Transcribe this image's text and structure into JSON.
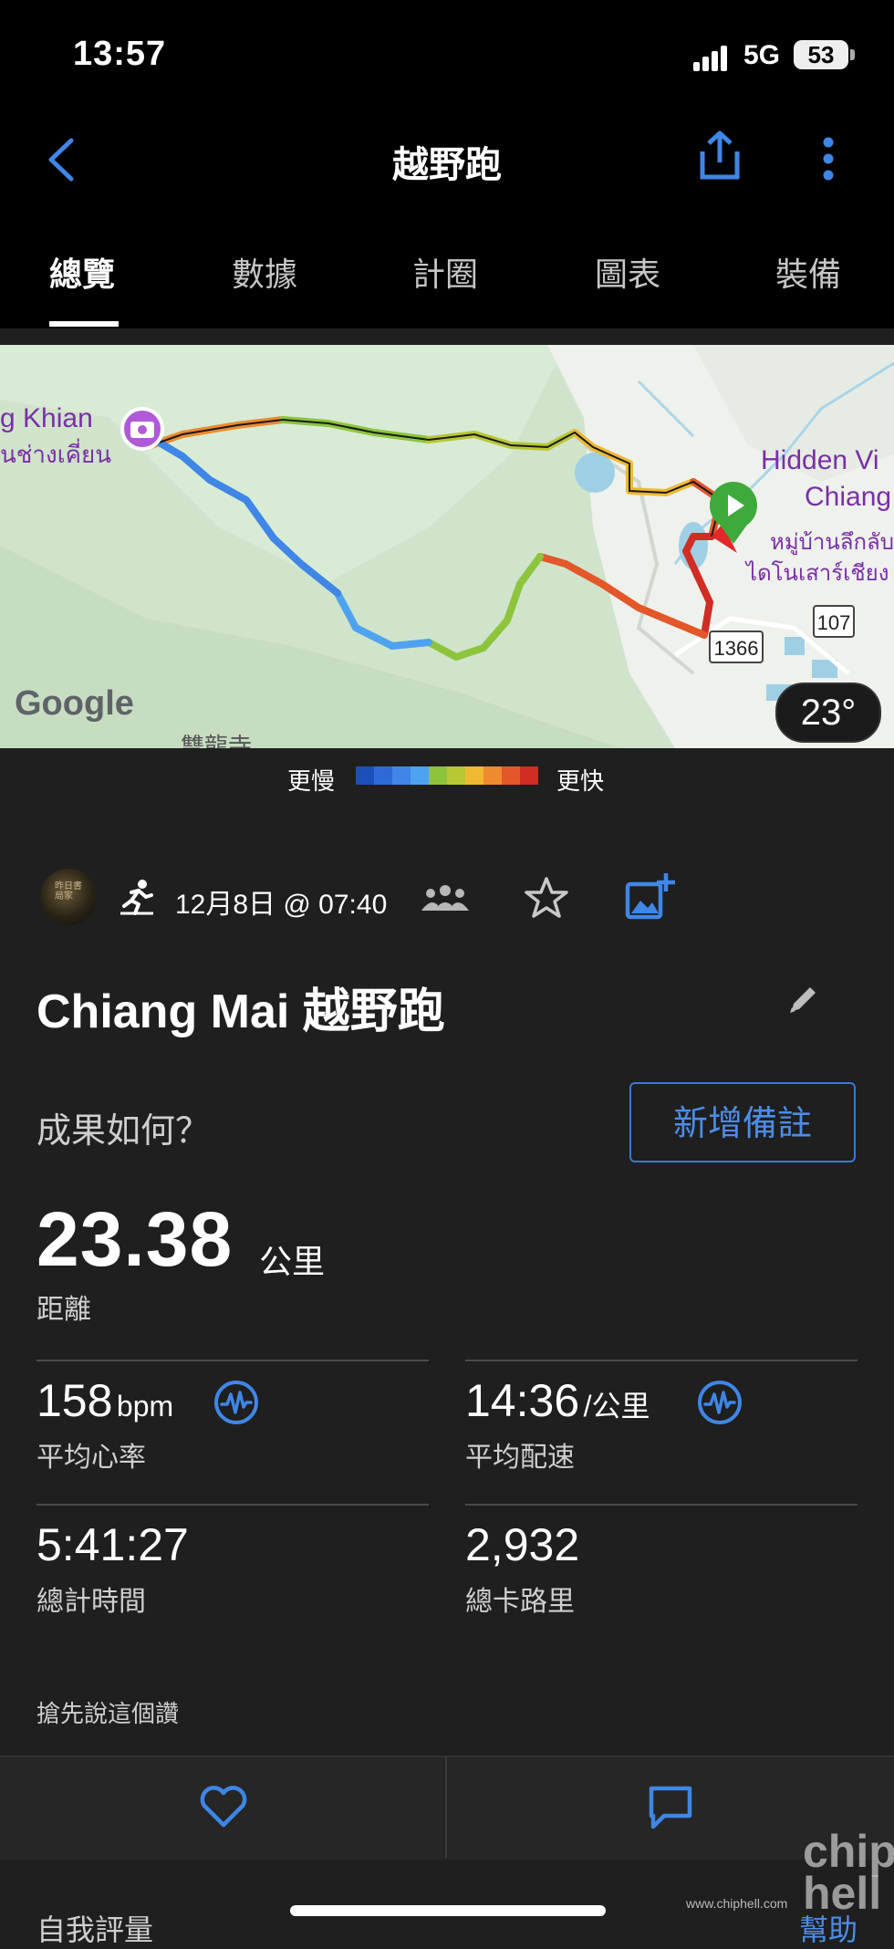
{
  "status_bar": {
    "time": "13:57",
    "network": "5G",
    "battery": "53"
  },
  "header": {
    "title": "越野跑",
    "back_icon": "chevron-left-icon",
    "share_icon": "share-icon",
    "more_icon": "more-vertical-icon"
  },
  "tabs": [
    {
      "label": "總覽",
      "active": true
    },
    {
      "label": "數據"
    },
    {
      "label": "計圈"
    },
    {
      "label": "圖表"
    },
    {
      "label": "裝備"
    }
  ],
  "map": {
    "label_left_en": "g Khian",
    "label_left_th": "นช่างเคี่ยน",
    "label_right_1": "Hidden Vi",
    "label_right_2": "Chiang",
    "label_right_3": "หมู่บ้านลึกลับ",
    "label_right_4": "ไดโนเสาร์เชียง",
    "road_1": "1366",
    "road_2": "107",
    "bottom_label": "雙龍寺",
    "google": "Google",
    "temperature": "23°"
  },
  "pace_legend": {
    "slower": "更慢",
    "faster": "更快",
    "colors": [
      "#1d4fb8",
      "#2d6ad6",
      "#3f86e6",
      "#4ea3f0",
      "#8cc43c",
      "#b8c734",
      "#f0b933",
      "#ee8a2f",
      "#e4572a",
      "#d02d24"
    ]
  },
  "activity": {
    "date_time": "12月8日 @ 07:40",
    "name": "Chiang Mai 越野跑",
    "prompt": "成果如何？",
    "add_note": "新增備註",
    "avatar_text": "昨日書局家"
  },
  "stats": {
    "distance": {
      "value": "23.38",
      "unit": "公里",
      "label": "距離"
    },
    "avg_hr": {
      "value": "158",
      "unit": "bpm",
      "label": "平均心率"
    },
    "avg_pace": {
      "value": "14:36",
      "unit": "/公里",
      "label": "平均配速"
    },
    "total_time": {
      "value": "5:41:27",
      "label": "總計時間"
    },
    "calories": {
      "value": "2,932",
      "label": "總卡路里"
    }
  },
  "social": {
    "like_prompt": "搶先說這個讚"
  },
  "bottom": {
    "self_eval": "自我評量",
    "help": "幫助"
  },
  "watermark": {
    "url": "www.chiphell.com",
    "logo": "chip hell"
  }
}
